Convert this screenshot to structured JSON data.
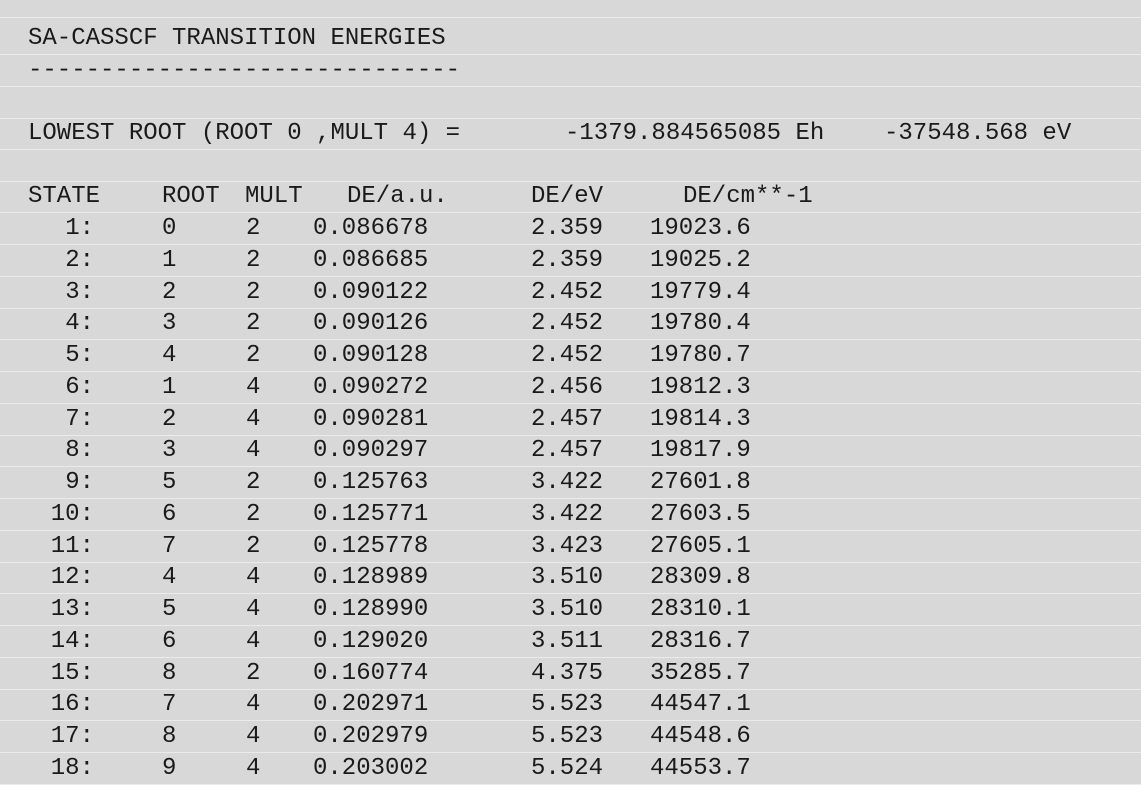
{
  "top_separator": "------------------------------",
  "section_title": "SA-CASSCF TRANSITION ENERGIES",
  "separator": "------------------------------",
  "lowest_root": {
    "label": "LOWEST ROOT (ROOT 0 ,MULT 4) =",
    "energy_eh": "-1379.884565085 Eh",
    "energy_ev": "-37548.568 eV"
  },
  "table": {
    "headers": {
      "state": "STATE",
      "root": "ROOT",
      "mult": "MULT",
      "de_au": "DE/a.u.",
      "de_ev": "DE/eV",
      "de_cm": "DE/cm**-1"
    },
    "rows": [
      {
        "state": "1:",
        "root": "0",
        "mult": "2",
        "de_au": "0.086678",
        "de_ev": "2.359",
        "de_cm": "19023.6"
      },
      {
        "state": "2:",
        "root": "1",
        "mult": "2",
        "de_au": "0.086685",
        "de_ev": "2.359",
        "de_cm": "19025.2"
      },
      {
        "state": "3:",
        "root": "2",
        "mult": "2",
        "de_au": "0.090122",
        "de_ev": "2.452",
        "de_cm": "19779.4"
      },
      {
        "state": "4:",
        "root": "3",
        "mult": "2",
        "de_au": "0.090126",
        "de_ev": "2.452",
        "de_cm": "19780.4"
      },
      {
        "state": "5:",
        "root": "4",
        "mult": "2",
        "de_au": "0.090128",
        "de_ev": "2.452",
        "de_cm": "19780.7"
      },
      {
        "state": "6:",
        "root": "1",
        "mult": "4",
        "de_au": "0.090272",
        "de_ev": "2.456",
        "de_cm": "19812.3"
      },
      {
        "state": "7:",
        "root": "2",
        "mult": "4",
        "de_au": "0.090281",
        "de_ev": "2.457",
        "de_cm": "19814.3"
      },
      {
        "state": "8:",
        "root": "3",
        "mult": "4",
        "de_au": "0.090297",
        "de_ev": "2.457",
        "de_cm": "19817.9"
      },
      {
        "state": "9:",
        "root": "5",
        "mult": "2",
        "de_au": "0.125763",
        "de_ev": "3.422",
        "de_cm": "27601.8"
      },
      {
        "state": "10:",
        "root": "6",
        "mult": "2",
        "de_au": "0.125771",
        "de_ev": "3.422",
        "de_cm": "27603.5"
      },
      {
        "state": "11:",
        "root": "7",
        "mult": "2",
        "de_au": "0.125778",
        "de_ev": "3.423",
        "de_cm": "27605.1"
      },
      {
        "state": "12:",
        "root": "4",
        "mult": "4",
        "de_au": "0.128989",
        "de_ev": "3.510",
        "de_cm": "28309.8"
      },
      {
        "state": "13:",
        "root": "5",
        "mult": "4",
        "de_au": "0.128990",
        "de_ev": "3.510",
        "de_cm": "28310.1"
      },
      {
        "state": "14:",
        "root": "6",
        "mult": "4",
        "de_au": "0.129020",
        "de_ev": "3.511",
        "de_cm": "28316.7"
      },
      {
        "state": "15:",
        "root": "8",
        "mult": "2",
        "de_au": "0.160774",
        "de_ev": "4.375",
        "de_cm": "35285.7"
      },
      {
        "state": "16:",
        "root": "7",
        "mult": "4",
        "de_au": "0.202971",
        "de_ev": "5.523",
        "de_cm": "44547.1"
      },
      {
        "state": "17:",
        "root": "8",
        "mult": "4",
        "de_au": "0.202979",
        "de_ev": "5.523",
        "de_cm": "44548.6"
      },
      {
        "state": "18:",
        "root": "9",
        "mult": "4",
        "de_au": "0.203002",
        "de_ev": "5.524",
        "de_cm": "44553.7"
      }
    ]
  }
}
